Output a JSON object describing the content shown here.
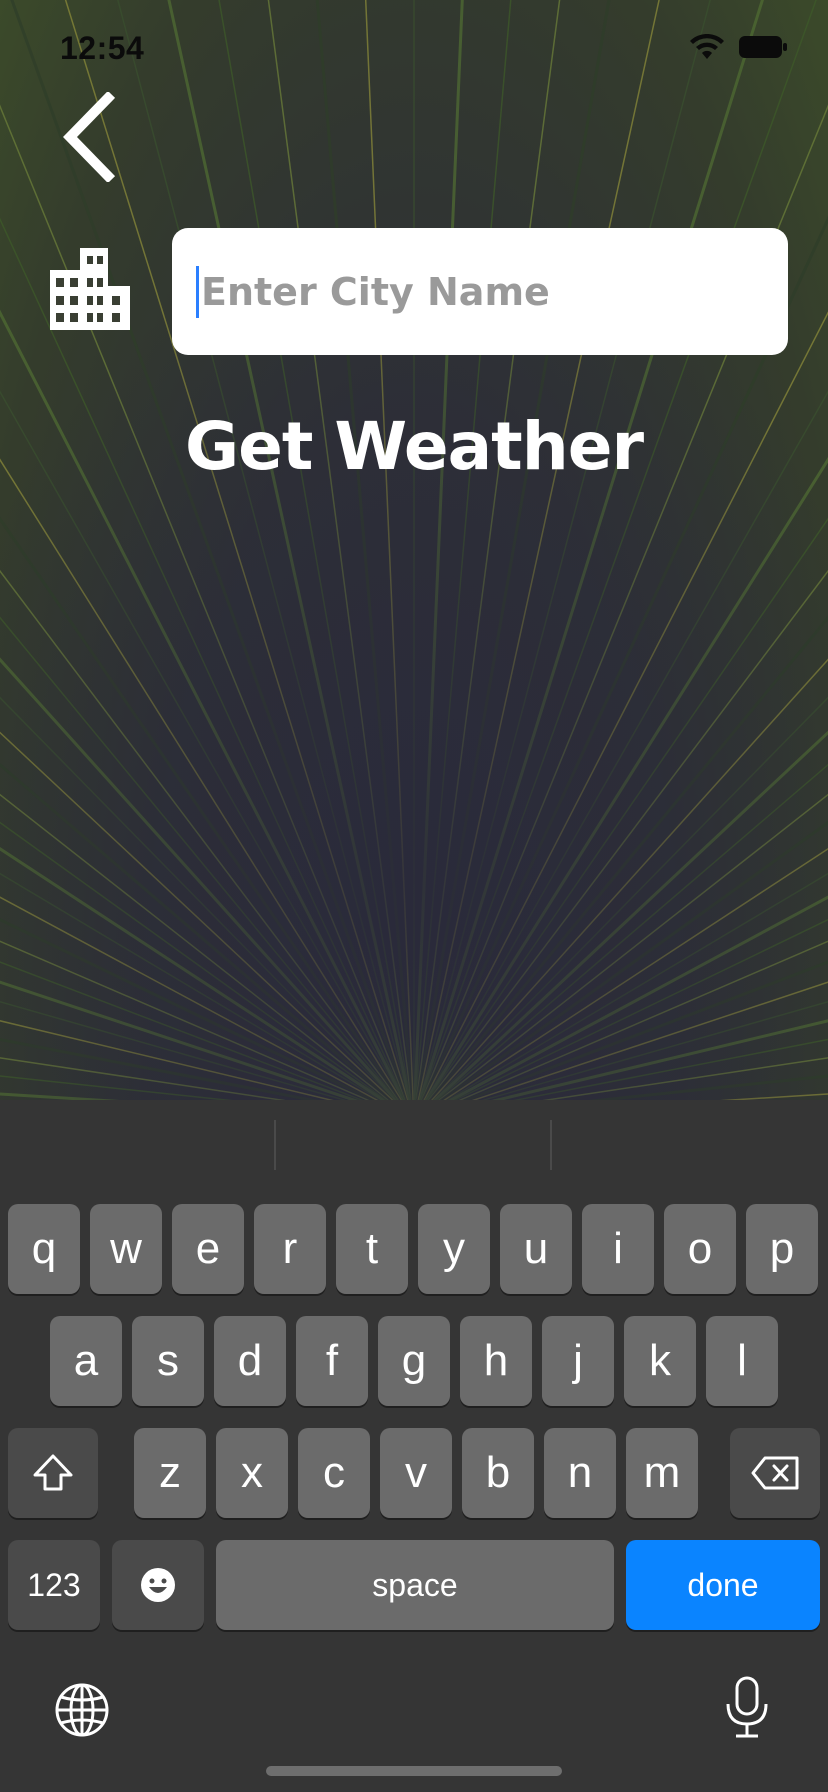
{
  "status_bar": {
    "time": "12:54",
    "wifi_icon": "wifi-icon",
    "battery_icon": "battery-icon"
  },
  "header": {
    "back_icon": "chevron-left-icon"
  },
  "search": {
    "icon": "city-icon",
    "placeholder": "Enter City Name",
    "value": ""
  },
  "action": {
    "label": "Get Weather"
  },
  "keyboard": {
    "row1": [
      "q",
      "w",
      "e",
      "r",
      "t",
      "y",
      "u",
      "i",
      "o",
      "p"
    ],
    "row2": [
      "a",
      "s",
      "d",
      "f",
      "g",
      "h",
      "j",
      "k",
      "l"
    ],
    "row3": [
      "z",
      "x",
      "c",
      "v",
      "b",
      "n",
      "m"
    ],
    "numbers_label": "123",
    "space_label": "space",
    "done_label": "done",
    "accent_color": "#0a84ff",
    "icons": [
      "shift-icon",
      "backspace-icon",
      "emoji-icon",
      "globe-icon",
      "microphone-icon"
    ]
  }
}
